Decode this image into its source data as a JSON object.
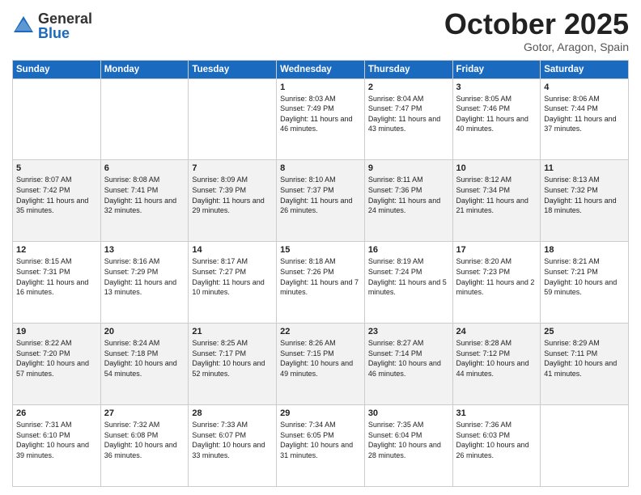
{
  "header": {
    "logo_general": "General",
    "logo_blue": "Blue",
    "month": "October 2025",
    "location": "Gotor, Aragon, Spain"
  },
  "days_of_week": [
    "Sunday",
    "Monday",
    "Tuesday",
    "Wednesday",
    "Thursday",
    "Friday",
    "Saturday"
  ],
  "weeks": [
    [
      {
        "day": "",
        "content": ""
      },
      {
        "day": "",
        "content": ""
      },
      {
        "day": "",
        "content": ""
      },
      {
        "day": "1",
        "content": "Sunrise: 8:03 AM\nSunset: 7:49 PM\nDaylight: 11 hours and 46 minutes."
      },
      {
        "day": "2",
        "content": "Sunrise: 8:04 AM\nSunset: 7:47 PM\nDaylight: 11 hours and 43 minutes."
      },
      {
        "day": "3",
        "content": "Sunrise: 8:05 AM\nSunset: 7:46 PM\nDaylight: 11 hours and 40 minutes."
      },
      {
        "day": "4",
        "content": "Sunrise: 8:06 AM\nSunset: 7:44 PM\nDaylight: 11 hours and 37 minutes."
      }
    ],
    [
      {
        "day": "5",
        "content": "Sunrise: 8:07 AM\nSunset: 7:42 PM\nDaylight: 11 hours and 35 minutes."
      },
      {
        "day": "6",
        "content": "Sunrise: 8:08 AM\nSunset: 7:41 PM\nDaylight: 11 hours and 32 minutes."
      },
      {
        "day": "7",
        "content": "Sunrise: 8:09 AM\nSunset: 7:39 PM\nDaylight: 11 hours and 29 minutes."
      },
      {
        "day": "8",
        "content": "Sunrise: 8:10 AM\nSunset: 7:37 PM\nDaylight: 11 hours and 26 minutes."
      },
      {
        "day": "9",
        "content": "Sunrise: 8:11 AM\nSunset: 7:36 PM\nDaylight: 11 hours and 24 minutes."
      },
      {
        "day": "10",
        "content": "Sunrise: 8:12 AM\nSunset: 7:34 PM\nDaylight: 11 hours and 21 minutes."
      },
      {
        "day": "11",
        "content": "Sunrise: 8:13 AM\nSunset: 7:32 PM\nDaylight: 11 hours and 18 minutes."
      }
    ],
    [
      {
        "day": "12",
        "content": "Sunrise: 8:15 AM\nSunset: 7:31 PM\nDaylight: 11 hours and 16 minutes."
      },
      {
        "day": "13",
        "content": "Sunrise: 8:16 AM\nSunset: 7:29 PM\nDaylight: 11 hours and 13 minutes."
      },
      {
        "day": "14",
        "content": "Sunrise: 8:17 AM\nSunset: 7:27 PM\nDaylight: 11 hours and 10 minutes."
      },
      {
        "day": "15",
        "content": "Sunrise: 8:18 AM\nSunset: 7:26 PM\nDaylight: 11 hours and 7 minutes."
      },
      {
        "day": "16",
        "content": "Sunrise: 8:19 AM\nSunset: 7:24 PM\nDaylight: 11 hours and 5 minutes."
      },
      {
        "day": "17",
        "content": "Sunrise: 8:20 AM\nSunset: 7:23 PM\nDaylight: 11 hours and 2 minutes."
      },
      {
        "day": "18",
        "content": "Sunrise: 8:21 AM\nSunset: 7:21 PM\nDaylight: 10 hours and 59 minutes."
      }
    ],
    [
      {
        "day": "19",
        "content": "Sunrise: 8:22 AM\nSunset: 7:20 PM\nDaylight: 10 hours and 57 minutes."
      },
      {
        "day": "20",
        "content": "Sunrise: 8:24 AM\nSunset: 7:18 PM\nDaylight: 10 hours and 54 minutes."
      },
      {
        "day": "21",
        "content": "Sunrise: 8:25 AM\nSunset: 7:17 PM\nDaylight: 10 hours and 52 minutes."
      },
      {
        "day": "22",
        "content": "Sunrise: 8:26 AM\nSunset: 7:15 PM\nDaylight: 10 hours and 49 minutes."
      },
      {
        "day": "23",
        "content": "Sunrise: 8:27 AM\nSunset: 7:14 PM\nDaylight: 10 hours and 46 minutes."
      },
      {
        "day": "24",
        "content": "Sunrise: 8:28 AM\nSunset: 7:12 PM\nDaylight: 10 hours and 44 minutes."
      },
      {
        "day": "25",
        "content": "Sunrise: 8:29 AM\nSunset: 7:11 PM\nDaylight: 10 hours and 41 minutes."
      }
    ],
    [
      {
        "day": "26",
        "content": "Sunrise: 7:31 AM\nSunset: 6:10 PM\nDaylight: 10 hours and 39 minutes."
      },
      {
        "day": "27",
        "content": "Sunrise: 7:32 AM\nSunset: 6:08 PM\nDaylight: 10 hours and 36 minutes."
      },
      {
        "day": "28",
        "content": "Sunrise: 7:33 AM\nSunset: 6:07 PM\nDaylight: 10 hours and 33 minutes."
      },
      {
        "day": "29",
        "content": "Sunrise: 7:34 AM\nSunset: 6:05 PM\nDaylight: 10 hours and 31 minutes."
      },
      {
        "day": "30",
        "content": "Sunrise: 7:35 AM\nSunset: 6:04 PM\nDaylight: 10 hours and 28 minutes."
      },
      {
        "day": "31",
        "content": "Sunrise: 7:36 AM\nSunset: 6:03 PM\nDaylight: 10 hours and 26 minutes."
      },
      {
        "day": "",
        "content": ""
      }
    ]
  ]
}
